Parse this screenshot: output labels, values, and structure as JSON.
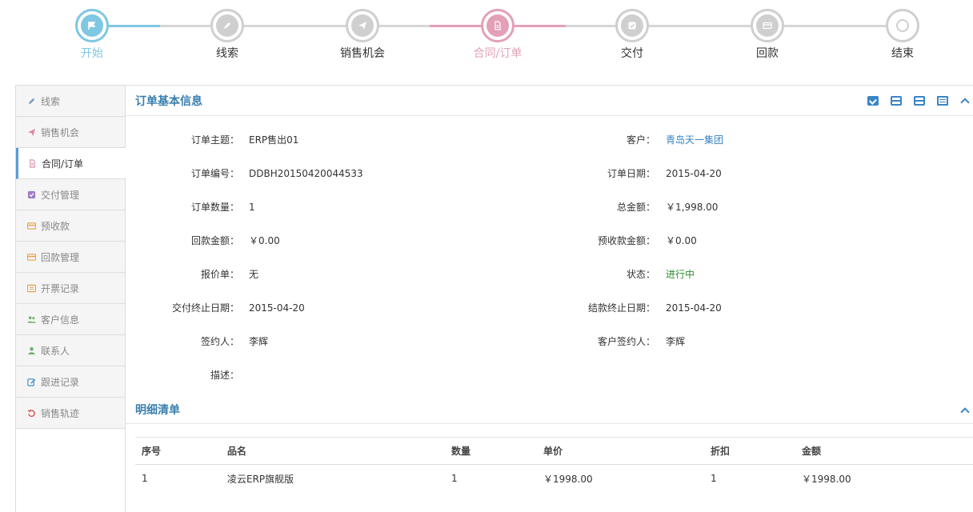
{
  "steps": [
    {
      "label": "开始",
      "icon": "flag-icon",
      "state": "start"
    },
    {
      "label": "线索",
      "icon": "pencil-icon",
      "state": "pending"
    },
    {
      "label": "销售机会",
      "icon": "paper-plane-icon",
      "state": "pending"
    },
    {
      "label": "合同/订单",
      "icon": "document-icon",
      "state": "current"
    },
    {
      "label": "交付",
      "icon": "check-square-icon",
      "state": "pending"
    },
    {
      "label": "回款",
      "icon": "credit-card-icon",
      "state": "pending"
    },
    {
      "label": "结束",
      "icon": "circle-icon",
      "state": "end"
    }
  ],
  "sidebar": {
    "items": [
      {
        "label": "线索",
        "icon": "pencil-icon",
        "color": "#7a9cc6"
      },
      {
        "label": "销售机会",
        "icon": "paper-plane-icon",
        "color": "#d98aa0"
      },
      {
        "label": "合同/订单",
        "icon": "document-icon",
        "color": "#d98aa0",
        "active": true
      },
      {
        "label": "交付管理",
        "icon": "check-square-icon",
        "color": "#a07cc5"
      },
      {
        "label": "预收款",
        "icon": "credit-card-icon",
        "color": "#e8a24a"
      },
      {
        "label": "回款管理",
        "icon": "credit-card-icon",
        "color": "#e8a24a"
      },
      {
        "label": "开票记录",
        "icon": "list-icon",
        "color": "#e8a24a"
      },
      {
        "label": "客户信息",
        "icon": "users-icon",
        "color": "#6fb36f"
      },
      {
        "label": "联系人",
        "icon": "user-icon",
        "color": "#6fb36f"
      },
      {
        "label": "跟进记录",
        "icon": "edit-icon",
        "color": "#3a85c6"
      },
      {
        "label": "销售轨迹",
        "icon": "history-icon",
        "color": "#d9534f"
      }
    ]
  },
  "order_info": {
    "title": "订单基本信息",
    "fields_left": [
      {
        "label": "订单主题：",
        "value": "ERP售出01"
      },
      {
        "label": "订单编号：",
        "value": "DDBH20150420044533"
      },
      {
        "label": "订单数量：",
        "value": "1"
      },
      {
        "label": "回款金额：",
        "value": "￥0.00"
      },
      {
        "label": "报价单：",
        "value": "无"
      },
      {
        "label": "交付终止日期：",
        "value": "2015-04-20"
      },
      {
        "label": "签约人：",
        "value": "李辉"
      },
      {
        "label": "描述：",
        "value": ""
      }
    ],
    "fields_right": [
      {
        "label": "客户：",
        "value": "青岛天一集团",
        "style": "link"
      },
      {
        "label": "订单日期：",
        "value": "2015-04-20"
      },
      {
        "label": "总金额：",
        "value": "￥1,998.00"
      },
      {
        "label": "预收款金额：",
        "value": "￥0.00"
      },
      {
        "label": "状态：",
        "value": "进行中",
        "style": "green"
      },
      {
        "label": "结款终止日期：",
        "value": "2015-04-20"
      },
      {
        "label": "客户签约人：",
        "value": "李辉"
      }
    ],
    "tools": [
      "check-square-icon",
      "credit-card-icon",
      "credit-card-icon",
      "list-icon",
      "chevron-up-icon"
    ]
  },
  "details": {
    "title": "明细清单",
    "columns": [
      "序号",
      "品名",
      "数量",
      "单价",
      "折扣",
      "金额"
    ],
    "rows": [
      [
        "1",
        "凌云ERP旗舰版",
        "1",
        "￥1998.00",
        "1",
        "￥1998.00"
      ]
    ]
  },
  "colors": {
    "accent_blue": "#3a85c6",
    "step_start": "#7fc7e3",
    "step_current": "#e3a0b6",
    "status_green": "#2e8b2e"
  }
}
